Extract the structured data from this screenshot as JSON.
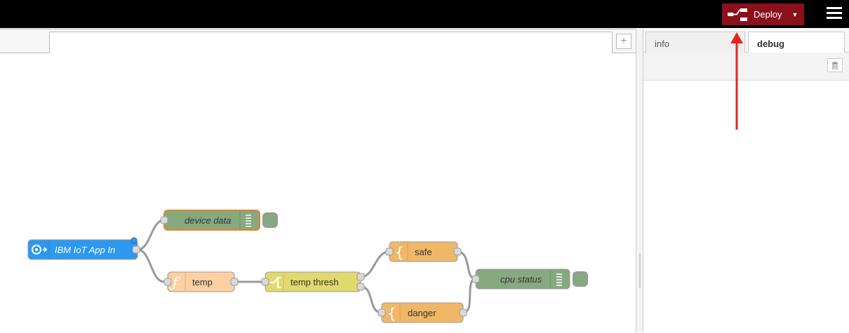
{
  "header": {
    "deploy_label": "Deploy"
  },
  "workspace": {
    "add_tab_glyph": "+"
  },
  "flow": {
    "nodes": {
      "ibm_iot": "IBM IoT App In",
      "device_data": "device data",
      "temp": "temp",
      "temp_thresh": "temp thresh",
      "safe": "safe",
      "danger": "danger",
      "cpu_status": "cpu status"
    },
    "node_colors": {
      "ibm_iot": "#2c98f0",
      "debug": "#87a980",
      "function": "#fdd0a2",
      "switch": "#e2d96e",
      "template": "#f0b866"
    }
  },
  "sidebar": {
    "tabs": [
      "info",
      "debug"
    ],
    "active_tab": "debug"
  },
  "annotation": {
    "arrow_color": "#e8231e"
  }
}
